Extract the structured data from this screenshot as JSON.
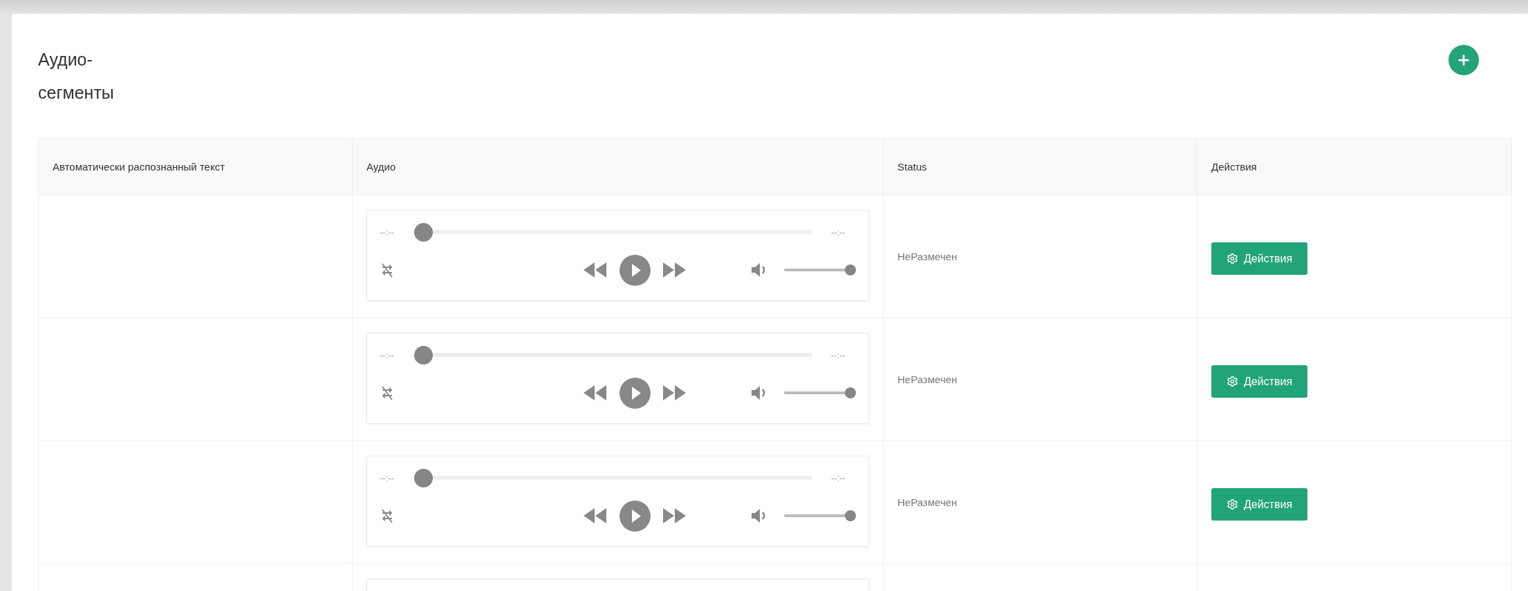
{
  "title_lines": [
    "Аудио-",
    "сегменты"
  ],
  "table": {
    "columns": [
      "Автоматически распознанный текст",
      "Аудио",
      "Status",
      "Действия"
    ],
    "rows": [
      {
        "player": {
          "elapsed": "--:--",
          "duration": "--:--",
          "seek": {
            "level": 0
          },
          "volume": {
            "level": 1
          }
        },
        "status": "НеРазмечен",
        "action": "Действия"
      },
      {
        "player": {
          "elapsed": "--:--",
          "duration": "--:--",
          "seek": {
            "level": 0
          },
          "volume": {
            "level": 1
          }
        },
        "status": "НеРазмечен",
        "action": "Действия"
      },
      {
        "player": {
          "elapsed": "--:--",
          "duration": "--:--",
          "seek": {
            "level": 0
          },
          "volume": {
            "level": 1
          }
        },
        "status": "НеРазмечен",
        "action": "Действия"
      },
      {
        "player": {
          "kind": "audio"
        }
      }
    ]
  }
}
